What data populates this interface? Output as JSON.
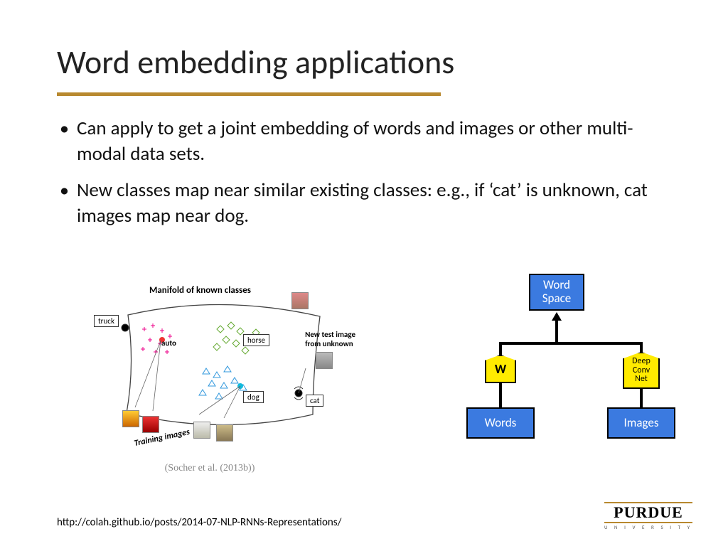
{
  "title": "Word embedding applications",
  "bullets": [
    "Can apply to get a joint embedding of words and images or other multi-modal data sets.",
    "New classes map near similar existing classes:  e.g., if ‘cat’ is unknown, cat images map near dog."
  ],
  "manifold": {
    "heading": "Manifold of known classes",
    "labels": {
      "truck": "truck",
      "auto": "auto",
      "horse": "horse",
      "dog": "dog",
      "cat": "cat"
    },
    "training_label": "Training images",
    "new_test_label_l1": "New test image",
    "new_test_label_l2": "from unknown"
  },
  "citation": "(Socher et al. (2013b))",
  "flow": {
    "word_space": "Word\nSpace",
    "w": "W",
    "deep": "Deep\nConv\nNet",
    "words": "Words",
    "images": "Images"
  },
  "footer_url": "http://colah.github.io/posts/2014-07-NLP-RNNs-Representations/",
  "logo": {
    "name": "PURDUE",
    "sub": "U N I V E R S I T Y"
  }
}
